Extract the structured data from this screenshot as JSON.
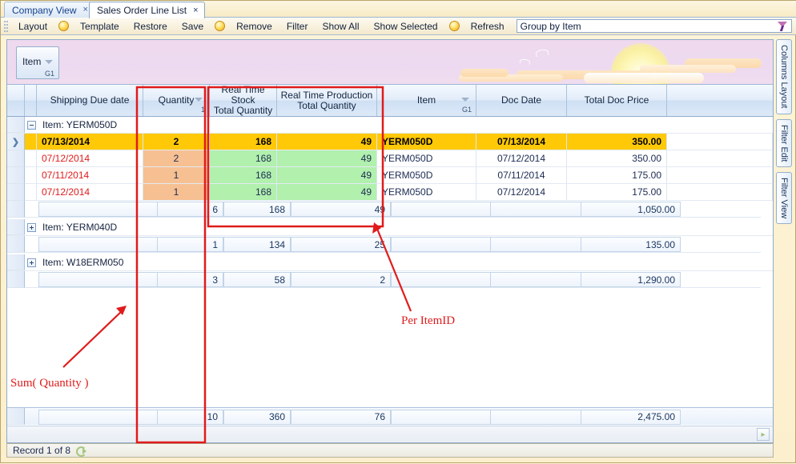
{
  "window": {
    "tabs": [
      {
        "label": "Company View",
        "active": false,
        "close": "×"
      },
      {
        "label": "Sales Order Line List",
        "active": true,
        "close": "×"
      }
    ]
  },
  "toolbar": {
    "layout": "Layout",
    "template": "Template",
    "restore": "Restore",
    "save": "Save",
    "remove": "Remove",
    "filter": "Filter",
    "show_all": "Show All",
    "show_selected": "Show Selected",
    "refresh": "Refresh",
    "combo_value": "Group by Item",
    "combo_icon": "filter-funnel-icon"
  },
  "group_panel": {
    "field": "Item",
    "group_index": "G1"
  },
  "columns": [
    {
      "label": "Shipping Due date",
      "sort": false,
      "group_index": ""
    },
    {
      "label": "Quantity",
      "sort": true,
      "group_index": "1"
    },
    {
      "label": "Real Time Stock\nTotal Quantity",
      "line1": "Real Time Stock",
      "line2": "Total Quantity"
    },
    {
      "label": "Real Time Production\nTotal Quantity",
      "line1": "Real Time Production",
      "line2": "Total Quantity"
    },
    {
      "label": "Item",
      "sort": true,
      "group_index": "G1"
    },
    {
      "label": "Doc Date"
    },
    {
      "label": "Total Doc Price"
    },
    {
      "label": ""
    }
  ],
  "groups": [
    {
      "header": "Item: YERM050D",
      "expanded": true,
      "rows": [
        {
          "ship": "07/13/2014",
          "qty": "2",
          "rts": "168",
          "rtp": "49",
          "item": "YERM050D",
          "doc": "07/13/2014",
          "price": "350.00",
          "selected": true
        },
        {
          "ship": "07/12/2014",
          "qty": "2",
          "rts": "168",
          "rtp": "49",
          "item": "YERM050D",
          "doc": "07/12/2014",
          "price": "350.00",
          "selected": false
        },
        {
          "ship": "07/11/2014",
          "qty": "1",
          "rts": "168",
          "rtp": "49",
          "item": "YERM050D",
          "doc": "07/11/2014",
          "price": "175.00",
          "selected": false
        },
        {
          "ship": "07/12/2014",
          "qty": "1",
          "rts": "168",
          "rtp": "49",
          "item": "YERM050D",
          "doc": "07/12/2014",
          "price": "175.00",
          "selected": false
        }
      ],
      "summary": {
        "qty": "6",
        "rts": "168",
        "rtp": "49",
        "price": "1,050.00"
      }
    },
    {
      "header": "Item: YERM040D",
      "expanded": false,
      "rows": [],
      "summary": {
        "qty": "1",
        "rts": "134",
        "rtp": "25",
        "price": "135.00"
      }
    },
    {
      "header": "Item: W18ERM050",
      "expanded": false,
      "rows": [],
      "summary": {
        "qty": "3",
        "rts": "58",
        "rtp": "2",
        "price": "1,290.00"
      }
    }
  ],
  "grand_total": {
    "qty": "10",
    "rts": "360",
    "rtp": "76",
    "price": "2,475.00"
  },
  "status": {
    "record": "Record 1 of 8",
    "icon": "refresh-icon"
  },
  "side_tabs": [
    {
      "label": "Columns Layout"
    },
    {
      "label": "Filter Edit"
    },
    {
      "label": "Filter View"
    }
  ],
  "annotations": [
    {
      "text": "Sum( Quantity )",
      "color": "#e01b1b"
    },
    {
      "text": "Per ItemID",
      "color": "#e01b1b"
    }
  ],
  "colors": {
    "selected_row": "#ffc907",
    "quantity_fill": "#f7c092",
    "realtime_fill": "#b1f0ad",
    "annotation": "#e01b1b",
    "date_text": "#e01b1b"
  }
}
